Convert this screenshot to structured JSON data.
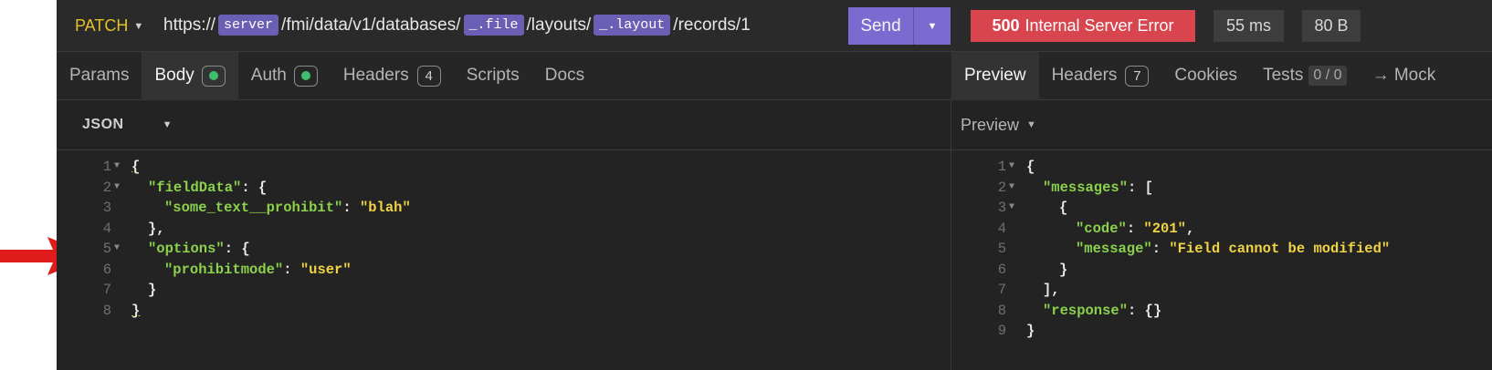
{
  "request": {
    "method": "PATCH",
    "url_parts": {
      "p1": "https://",
      "v1": "server",
      "p2": "/fmi/data/v1/databases/",
      "v2": "_.file",
      "p3": "/layouts/",
      "v3": "_.layout",
      "p4": "/records/1"
    },
    "send_label": "Send",
    "tabs": {
      "params": "Params",
      "body": "Body",
      "auth": "Auth",
      "headers": "Headers",
      "headers_count": "4",
      "scripts": "Scripts",
      "docs": "Docs"
    },
    "body_format": "JSON",
    "code_lines": [
      {
        "n": "1",
        "t": "{"
      },
      {
        "n": "2",
        "k": "\"fieldData\"",
        "t": ": {"
      },
      {
        "n": "3",
        "k": "\"some_text__prohibit\"",
        "t": ": ",
        "s": "\"blah\""
      },
      {
        "n": "4",
        "t": "},"
      },
      {
        "n": "5",
        "k": "\"options\"",
        "t": ": {"
      },
      {
        "n": "6",
        "k": "\"prohibitmode\"",
        "t": ": ",
        "s": "\"user\""
      },
      {
        "n": "7",
        "t": "}"
      },
      {
        "n": "8",
        "t": "}"
      }
    ]
  },
  "response": {
    "status_code": "500",
    "status_text": "Internal Server Error",
    "time": "55 ms",
    "size": "80 B",
    "tabs": {
      "preview": "Preview",
      "headers": "Headers",
      "headers_count": "7",
      "cookies": "Cookies",
      "tests": "Tests",
      "tests_count": "0 / 0",
      "mock": "→ Mock"
    },
    "view_mode": "Preview",
    "code_lines": [
      {
        "n": "1",
        "t": "{"
      },
      {
        "n": "2",
        "k": "\"messages\"",
        "t": ": ["
      },
      {
        "n": "3",
        "t": "{"
      },
      {
        "n": "4",
        "k": "\"code\"",
        "t": ": ",
        "s": "\"201\"",
        "e": ","
      },
      {
        "n": "5",
        "k": "\"message\"",
        "t": ": ",
        "s": "\"Field cannot be modified\""
      },
      {
        "n": "6",
        "t": "}"
      },
      {
        "n": "7",
        "t": "],"
      },
      {
        "n": "8",
        "k": "\"response\"",
        "t": ": {}"
      },
      {
        "n": "9",
        "t": "}"
      }
    ]
  },
  "colors": {
    "accent": "#7b6bd0",
    "error": "#d9454f",
    "method": "#e4c028",
    "json_key": "#8bd14c",
    "json_string": "#f0d443"
  },
  "icons": {
    "arrow": "red-arrow-icon",
    "caret": "caret-down-icon",
    "dot": "green-dot-icon"
  }
}
